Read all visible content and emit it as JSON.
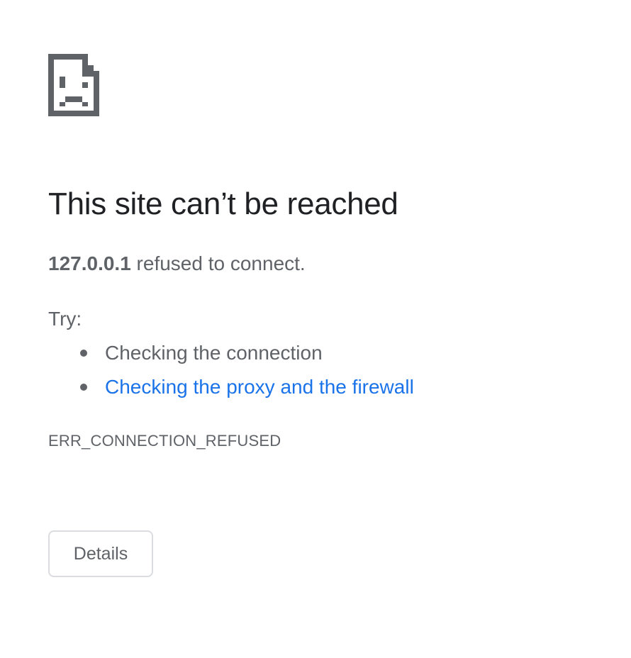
{
  "icon": "sad-document-icon",
  "title": "This site can’t be reached",
  "summary": {
    "host": "127.0.0.1",
    "message": " refused to connect."
  },
  "try_label": "Try:",
  "suggestions": [
    {
      "text": "Checking the connection",
      "is_link": false
    },
    {
      "text": "Checking the proxy and the firewall",
      "is_link": true
    }
  ],
  "error_code": "ERR_CONNECTION_REFUSED",
  "details_button_label": "Details",
  "colors": {
    "title": "#202124",
    "body_text": "#5f6368",
    "link": "#1a73e8",
    "icon": "#5f6368",
    "button_border": "#dadce0"
  }
}
